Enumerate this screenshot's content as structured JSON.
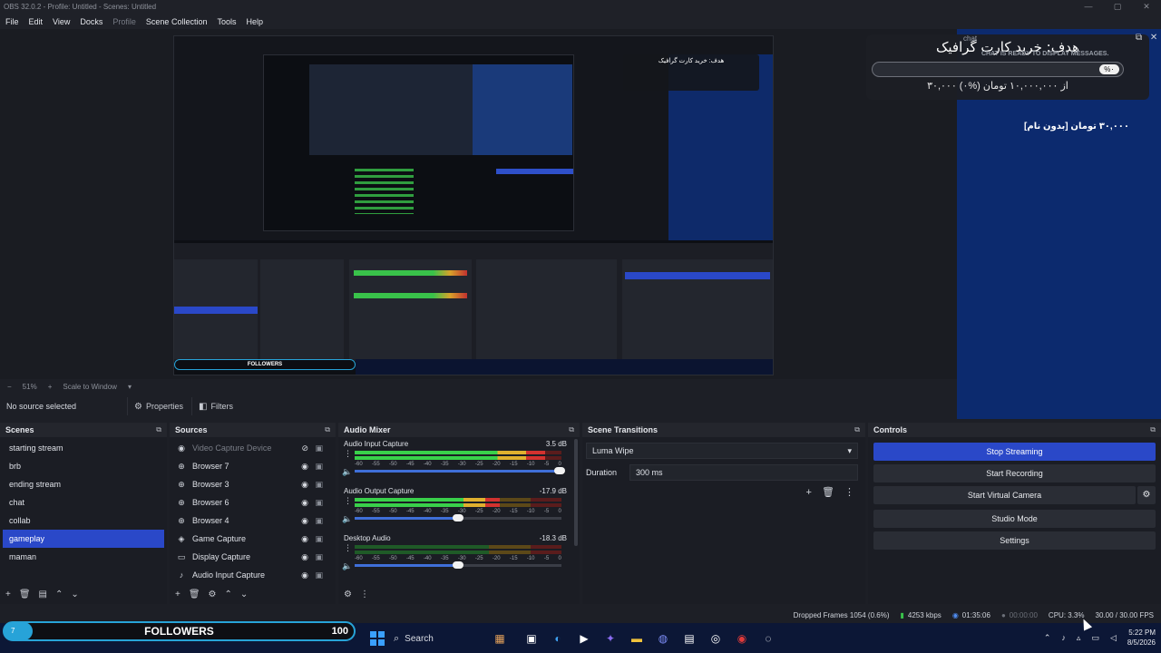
{
  "window": {
    "title": "OBS 32.0.2 - Profile: Untitled - Scenes: Untitled",
    "controls": [
      "—",
      "▢",
      "✕"
    ]
  },
  "menu": [
    "File",
    "Edit",
    "View",
    "Docks",
    "Profile",
    "Scene Collection",
    "Tools",
    "Help"
  ],
  "preview": {
    "zoom": "51%",
    "scale_mode": "Scale to Window"
  },
  "overlay": {
    "goal_title": "هدف: خرید کارت گرافیک",
    "goal_percent": "%۰",
    "goal_amount": "۳۰,۰۰۰ از ۱۰,۰۰۰,۰۰۰ تومان (%۰)",
    "chat_label": "chat",
    "chat_message": "CHAT IS READY TO DISPLAY MESSAGES.",
    "donation_line": "[بدون نام] ۳۰,۰۰۰ تومان"
  },
  "source_toolbar": {
    "no_source": "No source selected",
    "properties": "Properties",
    "filters": "Filters"
  },
  "scenes": {
    "title": "Scenes",
    "items": [
      "starting stream",
      "brb",
      "ending stream",
      "chat",
      "collab",
      "gameplay",
      "maman"
    ],
    "selected_index": 5
  },
  "sources": {
    "title": "Sources",
    "items": [
      {
        "name": "Video Capture Device",
        "icon": "camera-icon",
        "glyph": "◉",
        "hidden": true
      },
      {
        "name": "Browser 7",
        "icon": "globe-icon",
        "glyph": "⊕",
        "hidden": false
      },
      {
        "name": "Browser 3",
        "icon": "globe-icon",
        "glyph": "⊕",
        "hidden": false
      },
      {
        "name": "Browser 6",
        "icon": "globe-icon",
        "glyph": "⊕",
        "hidden": false
      },
      {
        "name": "Browser 4",
        "icon": "globe-icon",
        "glyph": "⊕",
        "hidden": false
      },
      {
        "name": "Game Capture",
        "icon": "gamepad-icon",
        "glyph": "◈",
        "hidden": false
      },
      {
        "name": "Display Capture",
        "icon": "monitor-icon",
        "glyph": "▭",
        "hidden": false
      },
      {
        "name": "Audio Input Capture",
        "icon": "microphone-icon",
        "glyph": "♪",
        "hidden": false
      }
    ]
  },
  "mixer": {
    "title": "Audio Mixer",
    "scale": [
      "-60",
      "-55",
      "-50",
      "-45",
      "-40",
      "-35",
      "-30",
      "-25",
      "-20",
      "-15",
      "-10",
      "-5",
      "0"
    ],
    "channels": [
      {
        "name": "Audio Input Capture",
        "db": "3.5 dB",
        "level": 0.92,
        "volume": 1.0
      },
      {
        "name": "Audio Output Capture",
        "db": "-17.9 dB",
        "level": 0.7,
        "volume": 0.51
      },
      {
        "name": "Desktop Audio",
        "db": "-18.3 dB",
        "level": 0.0,
        "volume": 0.51
      }
    ]
  },
  "transitions": {
    "title": "Scene Transitions",
    "selected": "Luma Wipe",
    "duration_label": "Duration",
    "duration_value": "300 ms"
  },
  "controls": {
    "title": "Controls",
    "stop_streaming": "Stop Streaming",
    "start_recording": "Start Recording",
    "start_virtual_camera": "Start Virtual Camera",
    "studio_mode": "Studio Mode",
    "settings": "Settings"
  },
  "status": {
    "dropped_frames": "Dropped Frames 1054 (0.6%)",
    "bitrate": "4253 kbps",
    "stream_time": "01:35:06",
    "rec_time": "00:00:00",
    "cpu": "CPU: 3.3%",
    "fps": "30.00 / 30.00 FPS"
  },
  "followers": {
    "label": "FOLLOWERS",
    "badge": "7",
    "count": "100"
  },
  "taskbar": {
    "search_label": "Search",
    "time": "5:22 PM",
    "date": "8/5/2026"
  },
  "nested": {
    "followers": "FOLLOWERS",
    "count": "100"
  },
  "colors": {
    "accent": "#2a48c8",
    "panel": "#1b1d24",
    "overlay_blue": "#0c2a6e",
    "followers_border": "#27a3d8"
  }
}
